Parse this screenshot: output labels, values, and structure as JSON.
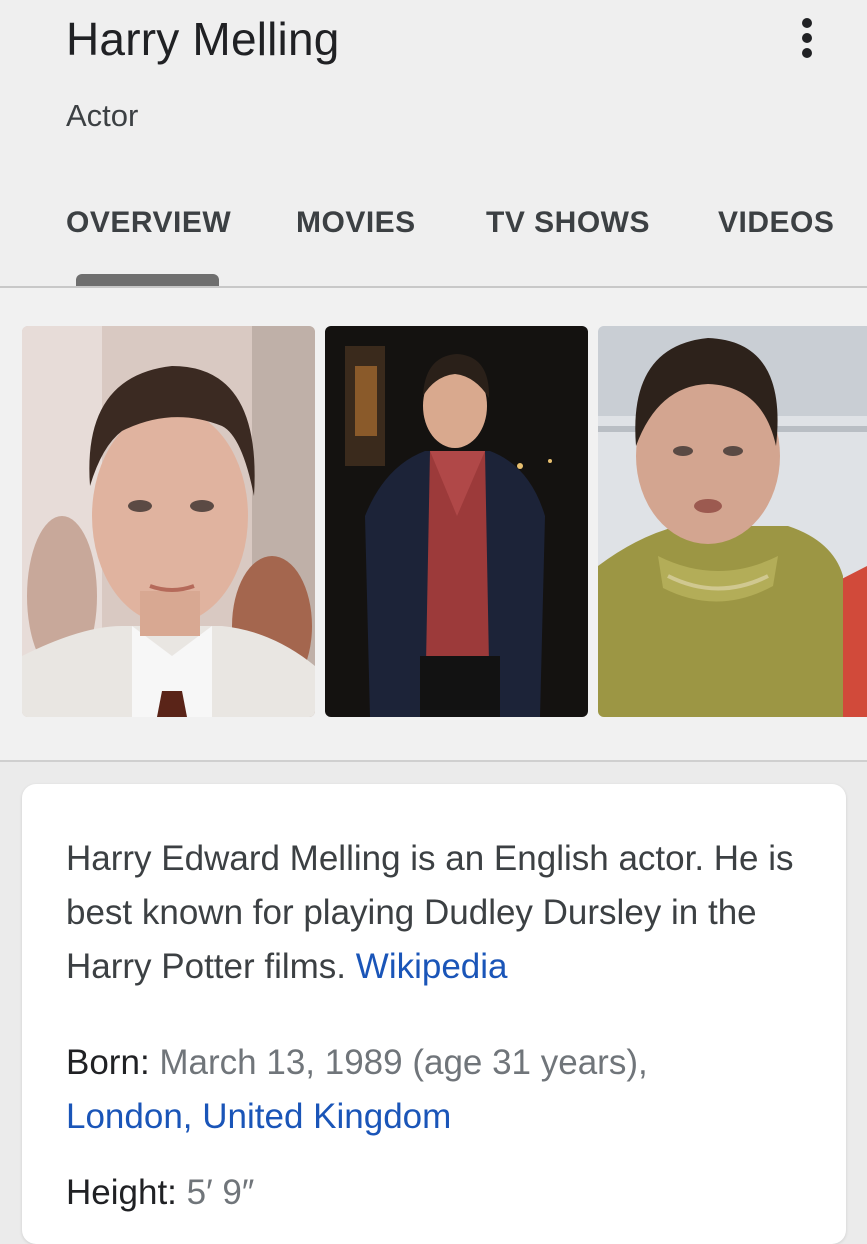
{
  "header": {
    "title": "Harry Melling",
    "subtitle": "Actor",
    "more_icon": "more-vert-icon"
  },
  "tabs": [
    {
      "label": "OVERVIEW",
      "selected": true
    },
    {
      "label": "MOVIES",
      "selected": false
    },
    {
      "label": "TV SHOWS",
      "selected": false
    },
    {
      "label": "VIDEOS",
      "selected": false
    }
  ],
  "description": {
    "text": "Harry Edward Melling is an English actor. He is best known for playing Dudley Dursley in the Harry Potter films.",
    "source": "Wikipedia"
  },
  "facts": {
    "born": {
      "label": "Born",
      "value": "March 13, 1989 (age 31 years),",
      "place": "London, United Kingdom"
    },
    "height": {
      "label": "Height",
      "value": "5′ 9″"
    }
  },
  "colors": {
    "link": "#1a55b8",
    "tab_indicator": "#6f6f6f"
  }
}
